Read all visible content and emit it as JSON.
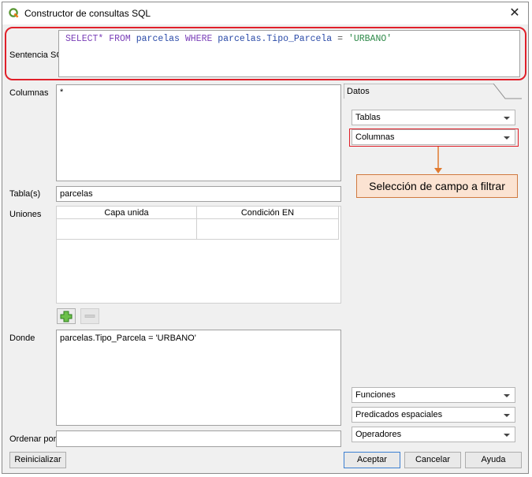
{
  "window": {
    "title": "Constructor de consultas SQL",
    "close_symbol": "✕"
  },
  "sql": {
    "label": "Sentencia SQL",
    "tokens": [
      {
        "t": "SELECT*",
        "c": "kw"
      },
      {
        "t": " ",
        "c": "op"
      },
      {
        "t": "FROM",
        "c": "kw"
      },
      {
        "t": " ",
        "c": "op"
      },
      {
        "t": "parcelas",
        "c": "ident"
      },
      {
        "t": " ",
        "c": "op"
      },
      {
        "t": "WHERE",
        "c": "kw"
      },
      {
        "t": " ",
        "c": "op"
      },
      {
        "t": "parcelas.Tipo_Parcela",
        "c": "ident"
      },
      {
        "t": " = ",
        "c": "op"
      },
      {
        "t": "'URBANO'",
        "c": "str"
      }
    ]
  },
  "columns": {
    "label": "Columnas",
    "value": "*"
  },
  "tables": {
    "label": "Tabla(s)",
    "value": "parcelas"
  },
  "joins": {
    "label": "Uniones",
    "headers": [
      "Capa unida",
      "Condición EN"
    ]
  },
  "where": {
    "label": "Donde",
    "value": "parcelas.Tipo_Parcela = 'URBANO'"
  },
  "order": {
    "label": "Ordenar por",
    "value": ""
  },
  "data_panel": {
    "tab_label": "Datos",
    "top_dropdowns": [
      "Tablas",
      "Columnas"
    ],
    "bottom_dropdowns": [
      "Funciones",
      "Predicados espaciales",
      "Operadores"
    ]
  },
  "annotation": {
    "text": "Selección de campo a filtrar",
    "accent": "#e0202a",
    "arrow_color": "#e07a30"
  },
  "buttons": {
    "reset": "Reinicializar",
    "accept": "Aceptar",
    "cancel": "Cancelar",
    "help": "Ayuda"
  },
  "colors": {
    "keyword": "#7a3fb8",
    "identifier": "#2a4aa8",
    "string": "#2f8a4a"
  }
}
